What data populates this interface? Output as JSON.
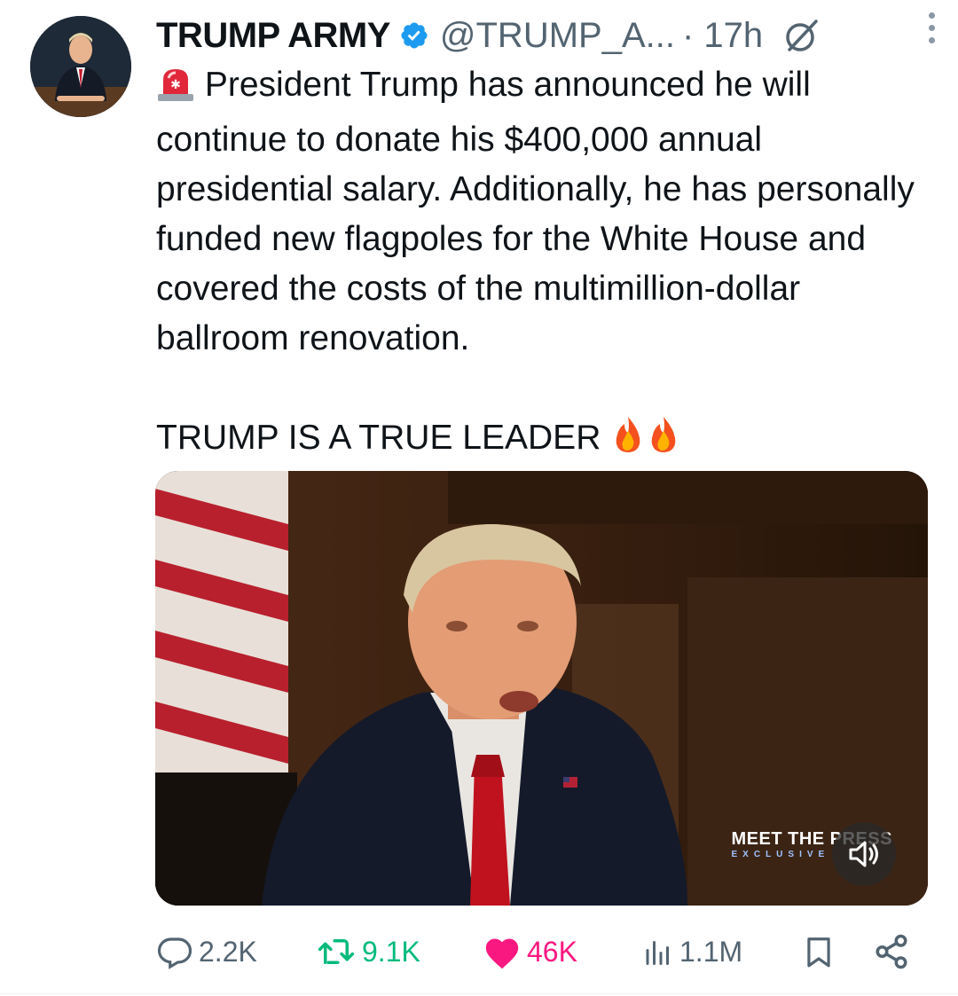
{
  "tweet": {
    "author_name": "TRUMP ARMY",
    "handle": "@TRUMP_A...",
    "time": "· 17h",
    "paragraph1": "President Trump has announced he will continue to donate his $400,000 annual presidential salary. Additionally, he has personally funded new flagpoles for the White House and covered the costs of the multimillion-dollar ballroom renovation.",
    "paragraph2": "TRUMP IS A TRUE LEADER",
    "media_overlay_text": "MEET THE PRESS",
    "media_overlay_sub": "EXCLUSIVE"
  },
  "actions": {
    "replies": "2.2K",
    "reposts": "9.1K",
    "likes": "46K",
    "views": "1.1M"
  },
  "icons": {
    "verified": "verified-badge-icon",
    "grok": "grok-icon",
    "siren": "siren-emoji",
    "fire": "fire-emoji",
    "reply": "reply-icon",
    "retweet": "retweet-icon",
    "like": "heart-icon",
    "views": "views-icon",
    "bookmark": "bookmark-icon",
    "share": "share-icon",
    "mute": "mute-icon"
  },
  "colors": {
    "verified": "#1d9bf0",
    "retweet": "#00ba7c",
    "like": "#f91880",
    "muted_text": "#536471"
  }
}
